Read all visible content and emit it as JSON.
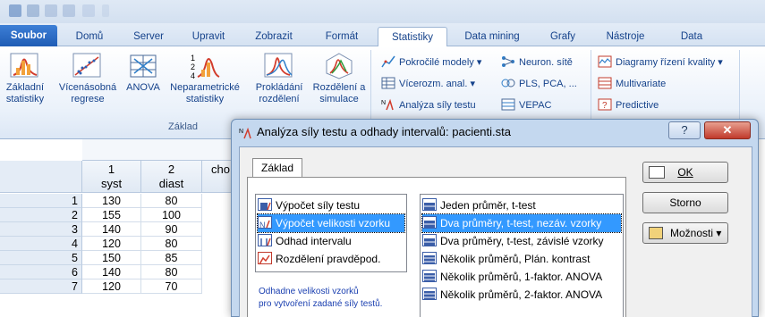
{
  "ribbon": {
    "tabs": [
      "Soubor",
      "Domů",
      "Server",
      "Upravit",
      "Zobrazit",
      "Formát",
      "Statistiky",
      "Data mining",
      "Grafy",
      "Nástroje",
      "Data"
    ],
    "active_tab": "Statistiky",
    "big_buttons": [
      {
        "label": "Základní\nstatistiky"
      },
      {
        "label": "Vícenásobná\nregrese"
      },
      {
        "label": "ANOVA"
      },
      {
        "label": "Neparametrické\nstatistiky"
      },
      {
        "label": "Prokládání\nrozdělení"
      },
      {
        "label": "Rozdělení a\nsimulace"
      }
    ],
    "group_label": "Základ",
    "small_buttons": [
      {
        "label": "Pokročilé modely ▾"
      },
      {
        "label": "Neuron. sítě"
      },
      {
        "label": "Vícerozm. anal. ▾"
      },
      {
        "label": "PLS, PCA, ..."
      },
      {
        "label": "Analýza síly testu"
      },
      {
        "label": "VEPAC"
      },
      {
        "label": "Diagramy řízení kvality ▾"
      },
      {
        "label": "Multivariate"
      },
      {
        "label": "Predictive"
      }
    ],
    "colors": {
      "file_tab": "#2a6bc4",
      "accent": "#15428b"
    }
  },
  "sheet": {
    "columns": [
      {
        "num": "1",
        "name": "syst"
      },
      {
        "num": "2",
        "name": "diast"
      },
      {
        "num": "",
        "name": "cho"
      }
    ],
    "rows": [
      {
        "n": "1",
        "syst": "130",
        "diast": "80"
      },
      {
        "n": "2",
        "syst": "155",
        "diast": "100"
      },
      {
        "n": "3",
        "syst": "140",
        "diast": "90"
      },
      {
        "n": "4",
        "syst": "120",
        "diast": "80"
      },
      {
        "n": "5",
        "syst": "150",
        "diast": "85"
      },
      {
        "n": "6",
        "syst": "140",
        "diast": "80"
      },
      {
        "n": "7",
        "syst": "120",
        "diast": "70"
      }
    ]
  },
  "dialog": {
    "title": "Analýza síly testu a odhady intervalů: pacienti.sta",
    "help_label": "?",
    "close_label": "✕",
    "tab": "Základ",
    "left_list": [
      {
        "label": "Výpočet síly testu",
        "selected": false
      },
      {
        "label": "Výpočet velikosti vzorku",
        "selected": true
      },
      {
        "label": "Odhad intervalu",
        "selected": false
      },
      {
        "label": "Rozdělení pravděpod.",
        "selected": false
      }
    ],
    "right_list": [
      {
        "label": "Jeden průměr, t-test",
        "selected": false
      },
      {
        "label": "Dva průměry, t-test, nezáv. vzorky",
        "selected": true
      },
      {
        "label": "Dva průměry, t-test, závislé vzorky",
        "selected": false
      },
      {
        "label": "Několik průměrů, Plán. kontrast",
        "selected": false
      },
      {
        "label": "Několik průměrů, 1-faktor. ANOVA",
        "selected": false
      },
      {
        "label": "Několik průměrů, 2-faktor. ANOVA",
        "selected": false
      }
    ],
    "hint_line1": "Odhadne velikosti vzorků",
    "hint_line2": "pro vytvoření zadané síly testů.",
    "ok_label": "OK",
    "storno_label": "Storno",
    "options_label": "Možnosti ▾"
  }
}
